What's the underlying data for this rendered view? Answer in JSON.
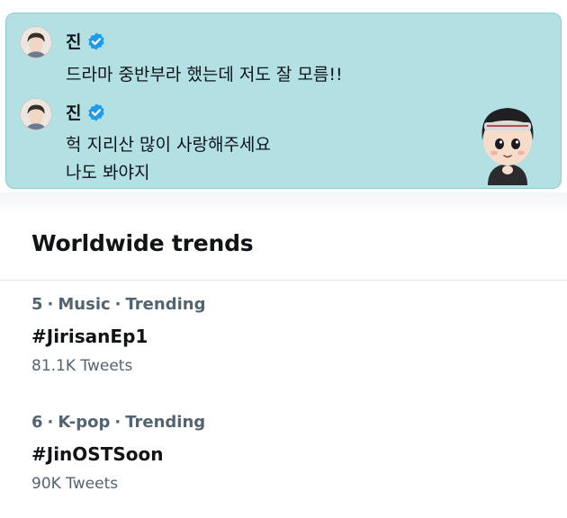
{
  "chat": {
    "messages": [
      {
        "sender": "진",
        "verified": true,
        "lines": [
          "드라마 중반부라 했는데 저도 잘 모름!!"
        ]
      },
      {
        "sender": "진",
        "verified": true,
        "lines": [
          "헉 지리산 많이 사랑해주세요",
          "나도 봐야지"
        ]
      }
    ],
    "sticker_icon": "character-sticker-icon",
    "colors": {
      "panel_bg": "#b3e0e3",
      "panel_border": "#8ccdd2",
      "verified_blue": "#1d9bf0"
    }
  },
  "trends": {
    "title": "Worldwide trends",
    "items": [
      {
        "rank": "5",
        "category": "Music",
        "status": "Trending",
        "name": "#JirisanEp1",
        "tweets": "81.1K Tweets"
      },
      {
        "rank": "6",
        "category": "K-pop",
        "status": "Trending",
        "name": "#JinOSTSoon",
        "tweets": "90K Tweets"
      }
    ],
    "separator": "·",
    "colors": {
      "text_primary": "#0f1419",
      "text_secondary": "#536471",
      "divider": "#e1e6ea"
    }
  }
}
